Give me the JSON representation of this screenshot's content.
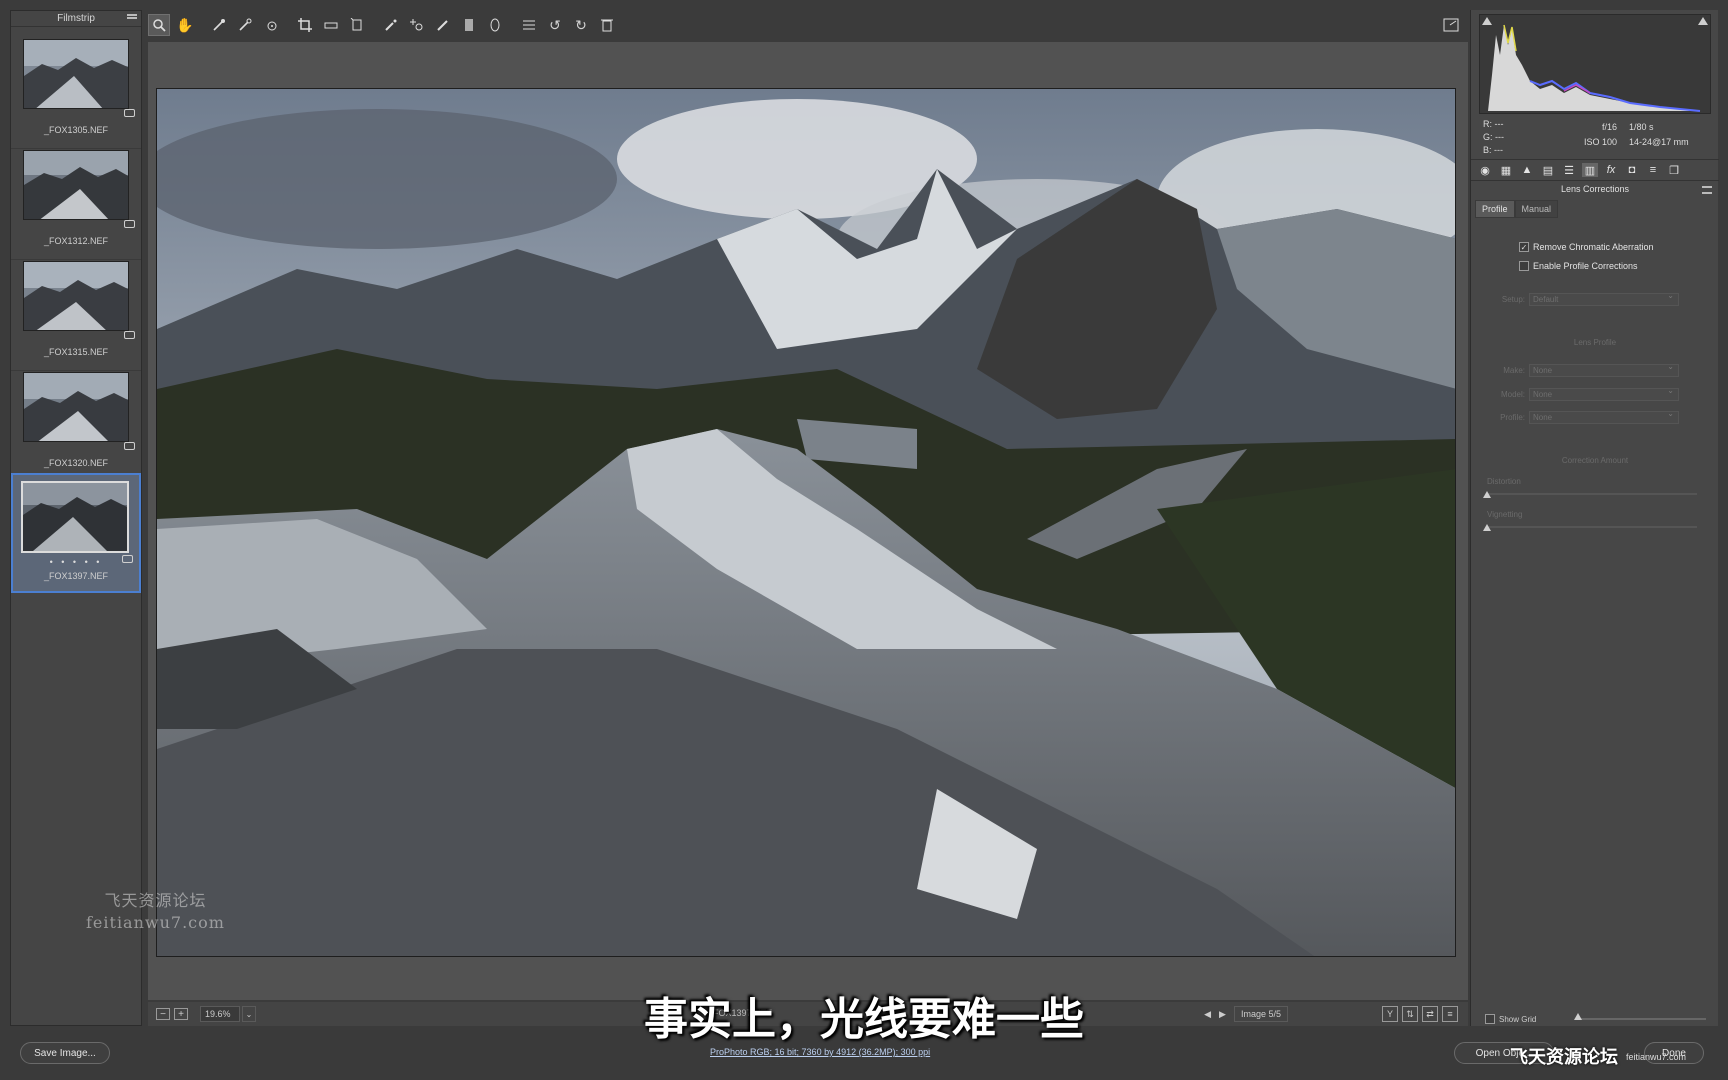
{
  "filmstrip": {
    "title": "Filmstrip",
    "items": [
      {
        "name": "_FOX1305.NEF",
        "selected": false
      },
      {
        "name": "_FOX1312.NEF",
        "selected": false
      },
      {
        "name": "_FOX1315.NEF",
        "selected": false
      },
      {
        "name": "_FOX1320.NEF",
        "selected": false
      },
      {
        "name": "_FOX1397.NEF",
        "selected": true,
        "rating_dots": "• • • • •"
      }
    ]
  },
  "toolbar": {
    "tools": [
      "zoom-tool",
      "hand-tool",
      "white-balance-tool",
      "color-sampler-tool",
      "targeted-adjustment-tool",
      "crop-tool",
      "straighten-tool",
      "transform-tool",
      "spot-removal-tool",
      "red-eye-tool",
      "adjustment-brush-tool",
      "graduated-filter-tool",
      "radial-filter-tool",
      "preferences-tool",
      "rotate-left-tool",
      "rotate-right-tool",
      "trash-tool"
    ],
    "active_tool": "zoom-tool"
  },
  "statusbar": {
    "zoom": "19.6%",
    "filename": "_FOX1397.NEF",
    "image_counter": "Image 5/5",
    "view_button": "Y"
  },
  "histogram": {
    "r": "R:  ---",
    "g": "G:  ---",
    "b": "B:  ---",
    "aperture": "f/16",
    "shutter": "1/80 s",
    "iso": "ISO 100",
    "lens": "14-24@17 mm"
  },
  "panel": {
    "title": "Lens Corrections",
    "tabs": [
      "Profile",
      "Manual"
    ],
    "active_tab": "Profile",
    "remove_ca": {
      "label": "Remove Chromatic Aberration",
      "checked": true
    },
    "enable_profile": {
      "label": "Enable Profile Corrections",
      "checked": false
    },
    "setup": {
      "label": "Setup:",
      "value": "Default"
    },
    "lens_profile_label": "Lens Profile",
    "make": {
      "label": "Make:",
      "value": "None"
    },
    "model": {
      "label": "Model:",
      "value": "None"
    },
    "profile": {
      "label": "Profile:",
      "value": "None"
    },
    "correction_amount_label": "Correction Amount",
    "distortion": {
      "label": "Distortion",
      "value": 0
    },
    "vignetting": {
      "label": "Vignetting",
      "value": 0
    },
    "show_grid": "Show Grid"
  },
  "bottom": {
    "save_button": "Save Image...",
    "workflow_link": "ProPhoto RGB; 16 bit; 7360 by 4912 (36.2MP); 300 ppi",
    "open_button": "Open Obje...",
    "done_button": "Done"
  },
  "overlay": {
    "subtitle": "事实上，光线要难一些",
    "watermark_cn": "飞天资源论坛",
    "watermark_en": "feitianwu7.com",
    "watermark2_cn": "飞天资源论坛",
    "watermark2_en": "feitianwu7.com"
  },
  "colors": {
    "selection_border": "#4b7fd1",
    "link": "#bcd0f0"
  }
}
